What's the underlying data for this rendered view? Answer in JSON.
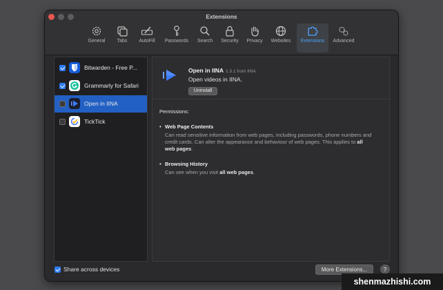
{
  "window": {
    "title": "Extensions"
  },
  "toolbar": {
    "items": [
      {
        "label": "General",
        "icon": "gear-icon"
      },
      {
        "label": "Tabs",
        "icon": "tabs-icon"
      },
      {
        "label": "AutoFill",
        "icon": "pencil-field-icon"
      },
      {
        "label": "Passwords",
        "icon": "key-icon"
      },
      {
        "label": "Search",
        "icon": "magnifier-icon"
      },
      {
        "label": "Security",
        "icon": "lock-icon"
      },
      {
        "label": "Privacy",
        "icon": "hand-icon"
      },
      {
        "label": "Websites",
        "icon": "globe-icon"
      },
      {
        "label": "Extensions",
        "icon": "puzzle-icon",
        "active": true
      },
      {
        "label": "Advanced",
        "icon": "gears-icon"
      }
    ]
  },
  "extensions": [
    {
      "name": "Bitwarden - Free P...",
      "checked": true,
      "icon": "bitwarden-shield-icon",
      "color": "#175ddc"
    },
    {
      "name": "Grammarly for Safari",
      "checked": true,
      "icon": "grammarly-icon",
      "color": "#15c39a"
    },
    {
      "name": "Open in IINA",
      "checked": false,
      "selected": true,
      "icon": "iina-play-icon",
      "color": "#3b7cff"
    },
    {
      "name": "TickTick",
      "checked": false,
      "icon": "ticktick-icon",
      "color": "#ffffff"
    }
  ],
  "detail": {
    "name": "Open in IINA",
    "version": "1.3.1 from IINA",
    "description": "Open videos in IINA.",
    "uninstall_label": "Uninstall",
    "permissions_title": "Permissions:",
    "permissions": [
      {
        "title": "Web Page Contents",
        "desc_pre": "Can read sensitive information from web pages, including passwords, phone numbers and credit cards. Can alter the appearance and behaviour of web pages. This applies to",
        "desc_bold": "all web pages",
        "desc_post": "."
      },
      {
        "title": "Browsing History",
        "desc_pre": "Can see when you visit",
        "desc_bold": "all web pages",
        "desc_post": "."
      }
    ]
  },
  "footer": {
    "share_label": "Share across devices",
    "share_checked": true,
    "more_label": "More Extensions...",
    "help_label": "?"
  },
  "watermark": "shenmazhishi.com",
  "colors": {
    "accent": "#2f7cf6",
    "selection": "#2360c4",
    "active_tab_label": "#4da3ff"
  }
}
